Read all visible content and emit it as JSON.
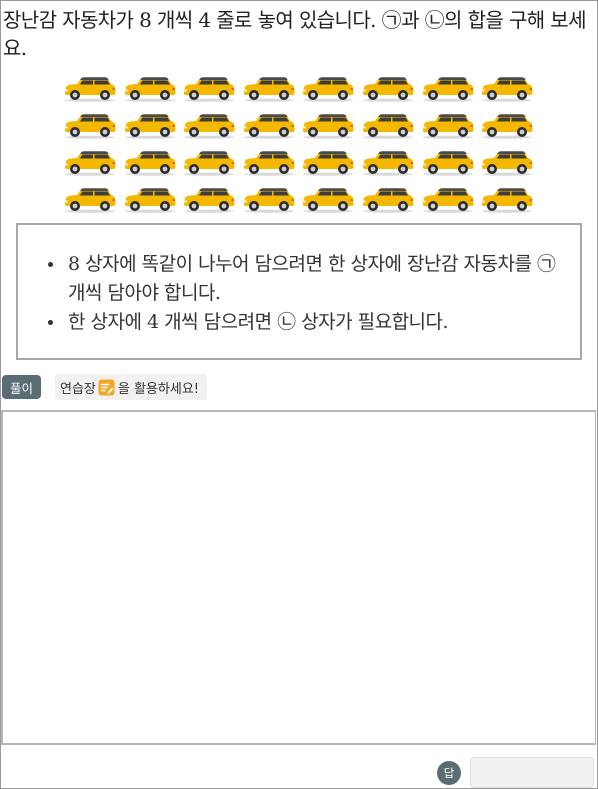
{
  "question": {
    "text": "장난감 자동차가 8 개씩 4 줄로 놓여 있습니다. ㉠과 ㉡의 합을 구해 보세요."
  },
  "cars": {
    "rows": 4,
    "per_row": 8,
    "icon": "toy-car-icon",
    "body_color": "#f5b800",
    "roof_color": "#4a4a4a"
  },
  "conditions": [
    "8 상자에 똑같이 나누어 담으려면 한 상자에 장난감 자동차를 ㉠ 개씩 담아야 합니다.",
    "한 상자에 4 개씩 담으려면 ㉡ 상자가 필요합니다."
  ],
  "solution": {
    "badge": "풀이",
    "hint_before": "연습장",
    "hint_after": "을 활용하세요!",
    "hint_icon": "notepad-icon"
  },
  "answer": {
    "badge": "답",
    "value": ""
  },
  "colors": {
    "badge_bg": "#5b6d74",
    "hint_icon": "#f6a623"
  }
}
